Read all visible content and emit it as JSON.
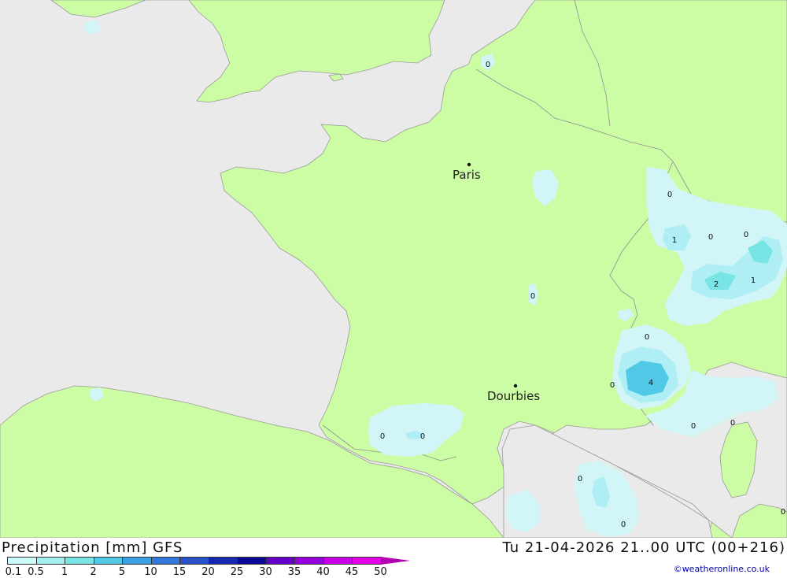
{
  "map": {
    "cities": [
      {
        "name": "Paris"
      },
      {
        "name": "Dourbies"
      }
    ],
    "precip_values": [
      "0",
      "0",
      "1",
      "0",
      "0",
      "2",
      "1",
      "0",
      "0",
      "4",
      "0",
      "0",
      "0",
      "0",
      "0",
      "0",
      "0",
      "0"
    ]
  },
  "footer": {
    "title_left": "Precipitation [mm] GFS",
    "title_right": "Tu 21-04-2026 21..00 UTC (00+216)",
    "credit": "©weatheronline.co.uk"
  },
  "legend": {
    "labels": [
      "0.1",
      "0.5",
      "1",
      "2",
      "5",
      "10",
      "15",
      "20",
      "25",
      "30",
      "35",
      "40",
      "45",
      "50"
    ],
    "colors": [
      "#ccfafa",
      "#a0f0f0",
      "#78e4e4",
      "#50c8e6",
      "#3ca0e6",
      "#3278dc",
      "#2850c8",
      "#1428b4",
      "#0a0a96",
      "#6400c8",
      "#9600dc",
      "#c800e6",
      "#e600e6",
      "#b400b4"
    ]
  },
  "colors": {
    "sea": "#eaeaea",
    "land": "#ccfca4",
    "light_precip": "#d2f6f8",
    "mid_precip": "#aeeef4",
    "heavy_precip": "#70d0ea"
  }
}
